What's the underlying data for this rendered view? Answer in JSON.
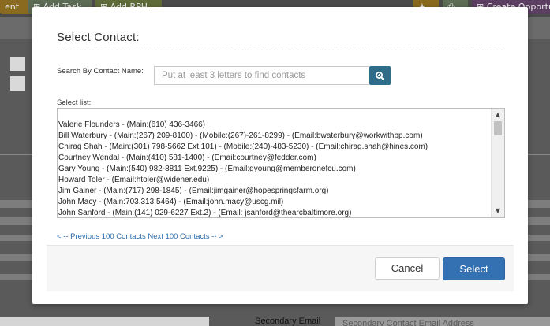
{
  "background": {
    "top_buttons": [
      "ent",
      "⊞ Add Task",
      "⊞ Add RPH",
      "⊞ Create Opportu"
    ],
    "secondary_email_label": "Secondary Email",
    "secondary_email_placeholder": "Secondary Contact Email Address"
  },
  "modal": {
    "title": "Select Contact:",
    "search": {
      "label": "Search By Contact Name:",
      "placeholder": "Put at least 3 letters to find contacts",
      "value": ""
    },
    "select_list_label": "Select list:",
    "contacts": [
      "Valerie Flounders - (Main:(610) 436-3466)",
      "Bill Waterbury - (Main:(267) 209-8100) - (Mobile:(267)-261-8299) - (Email:bwaterbury@workwithbp.com)",
      "Chirag Shah - (Main:(301) 798-5662 Ext.101) - (Mobile:(240)-483-5230) - (Email:chirag.shah@hines.com)",
      "Courtney Wendal - (Main:(410) 581-1400) - (Email:courtney@fedder.com)",
      "Gary Young - (Main:(540) 982-8811 Ext.9225) - (Email:gyoung@memberonefcu.com)",
      "Howard Toler - (Email:htoler@widener.edu)",
      "Jim Gainer - (Main:(717) 298-1845) - (Email:jimgainer@hopespringsfarm.org)",
      "John Macy - (Main:703.313.5464) - (Email:john.macy@uscg.mil)",
      "John Sanford - (Main:(141) 029-6227 Ext.2) - (Email: jsanford@thearcbaltimore.org)"
    ],
    "pager": {
      "previous": "< -- Previous 100 Contacts",
      "next": "Next 100 Contacts -- >"
    },
    "buttons": {
      "cancel": "Cancel",
      "select": "Select"
    }
  },
  "colors": {
    "primary": "#3371b3",
    "search_button": "#2e6c8a",
    "link": "#2a6aa8"
  }
}
